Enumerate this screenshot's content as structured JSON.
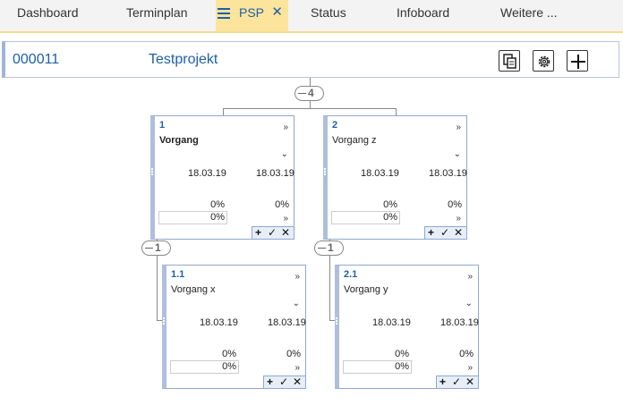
{
  "tabs": [
    {
      "label": "Dashboard"
    },
    {
      "label": "Terminplan"
    },
    {
      "label": "PSP"
    },
    {
      "label": "Status"
    },
    {
      "label": "Infoboard"
    },
    {
      "label": "Weitere ..."
    }
  ],
  "tab_close": "✕",
  "project": {
    "code": "000011",
    "name": "Testprojekt"
  },
  "collapse": {
    "root_count": "4",
    "node1_count": "1",
    "node2_count": "1"
  },
  "cards": [
    {
      "num": "1",
      "title": "Vorgang",
      "start": "18.03.19",
      "end": "18.03.19",
      "pct1": "0%",
      "pct2": "0%",
      "input": "0%"
    },
    {
      "num": "2",
      "title": "Vorgang z",
      "start": "18.03.19",
      "end": "18.03.19",
      "pct1": "0%",
      "pct2": "0%",
      "input": "0%"
    },
    {
      "num": "1.1",
      "title": "Vorgang x",
      "start": "18.03.19",
      "end": "18.03.19",
      "pct1": "0%",
      "pct2": "0%",
      "input": "0%"
    },
    {
      "num": "2.1",
      "title": "Vorgang y",
      "start": "18.03.19",
      "end": "18.03.19",
      "pct1": "0%",
      "pct2": "0%",
      "input": "0%"
    }
  ],
  "glyphs": {
    "more": "»",
    "chevron": "⌄",
    "add": "+",
    "check": "✓",
    "delete": "✕"
  },
  "colors": {
    "accent": "#1d5fa8",
    "active_tab": "#fce49c",
    "card_border": "#8ea8cf"
  }
}
